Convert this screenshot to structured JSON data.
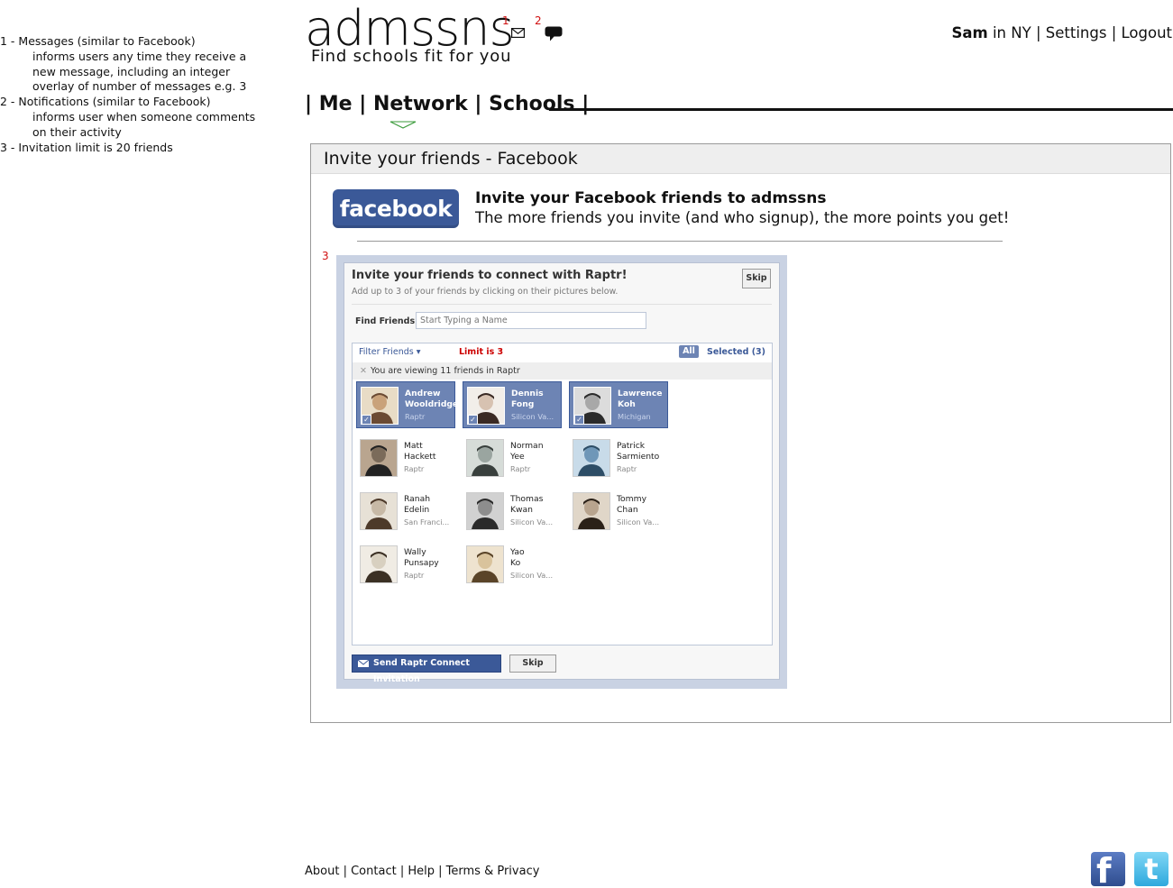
{
  "annotations": [
    {
      "title": "1 - Messages (similar to Facebook)",
      "desc": "informs users any time they receive a new message, including an integer overlay of number of messages e.g. 3"
    },
    {
      "title": "2 - Notifications (similar to Facebook)",
      "desc": "informs user when someone comments on their activity"
    },
    {
      "title": "3 - Invitation limit is 20 friends",
      "desc": ""
    }
  ],
  "header": {
    "logo": "admssns",
    "tagline": "Find schools fit for you",
    "messages_marker": "1",
    "notifications_marker": "2",
    "icons": [
      "mail-icon",
      "speech-bubble-icon"
    ]
  },
  "userbar": {
    "name": "Sam",
    "location": "in NY",
    "settings": "Settings",
    "logout": "Logout",
    "sep": "|"
  },
  "nav": {
    "sep": "|",
    "items": [
      "Me",
      "Network",
      "Schools"
    ],
    "active": "Network"
  },
  "panel": {
    "title": "Invite your friends - Facebook",
    "fb_button": "facebook",
    "invite_title": "Invite your Facebook friends to admssns",
    "invite_sub": "The more friends you invite (and who signup), the more points you get!",
    "marker": "3"
  },
  "dialog": {
    "title": "Invite your friends to connect with Raptr!",
    "subtitle": "Add up to 3 of your friends by clicking on their pictures below.",
    "skip_top": "Skip",
    "find_label": "Find Friends:",
    "find_placeholder": "Start Typing a Name",
    "filter_label": "Filter Friends",
    "limit_text": "Limit is 3",
    "all_label": "All",
    "selected_label": "Selected (3)",
    "viewing_text": "You are viewing 11 friends in Raptr",
    "friends": [
      {
        "first": "Andrew",
        "last": "Wooldridge",
        "network": "Raptr",
        "selected": true
      },
      {
        "first": "Dennis",
        "last": "Fong",
        "network": "Silicon Va...",
        "selected": true
      },
      {
        "first": "Lawrence",
        "last": "Koh",
        "network": "Michigan",
        "selected": true
      },
      {
        "first": "Matt",
        "last": "Hackett",
        "network": "Raptr",
        "selected": false
      },
      {
        "first": "Norman",
        "last": "Yee",
        "network": "Raptr",
        "selected": false
      },
      {
        "first": "Patrick",
        "last": "Sarmiento",
        "network": "Raptr",
        "selected": false
      },
      {
        "first": "Ranah",
        "last": "Edelin",
        "network": "San Franci...",
        "selected": false
      },
      {
        "first": "Thomas",
        "last": "Kwan",
        "network": "Silicon Va...",
        "selected": false
      },
      {
        "first": "Tommy",
        "last": "Chan",
        "network": "Silicon Va...",
        "selected": false
      },
      {
        "first": "Wally",
        "last": "Punsapy",
        "network": "Raptr",
        "selected": false
      },
      {
        "first": "Yao",
        "last": "Ko",
        "network": "Silicon Va...",
        "selected": false
      }
    ],
    "send_label": "Send Raptr Connect Invitation",
    "skip_bottom": "Skip"
  },
  "footer": {
    "about": "About",
    "contact": "Contact",
    "help": "Help",
    "terms": "Terms & Privacy",
    "sep": "|"
  },
  "social": {
    "facebook_glyph": "f",
    "twitter_glyph": "t",
    "icons": [
      "facebook-icon",
      "twitter-icon"
    ]
  },
  "colors": {
    "facebook_blue": "#3b5998",
    "selected_bg": "#6d84b4",
    "marker_red": "#d01010",
    "twitter_blue": "#2fa9dd"
  }
}
